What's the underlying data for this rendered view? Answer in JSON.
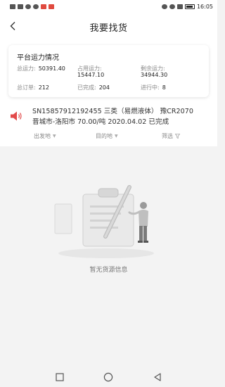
{
  "statusbar": {
    "time": "16:05"
  },
  "header": {
    "title": "我要找货"
  },
  "summary": {
    "title": "平台运力情况",
    "total_capacity_label": "总运力:",
    "total_capacity_value": "50391.40",
    "used_capacity_label": "占用运力:",
    "used_capacity_value": "15447.10",
    "remaining_capacity_label": "剩余运力:",
    "remaining_capacity_value": "34944.30",
    "total_orders_label": "总订单:",
    "total_orders_value": "212",
    "completed_label": "已完成:",
    "completed_value": "204",
    "in_progress_label": "进行中:",
    "in_progress_value": "8"
  },
  "notice": {
    "line1": "SN15857912192455 三类（易燃液体） 豫CR2070",
    "line2": "晋城市-洛阳市 70.00/吨 2020.04.02 已完成"
  },
  "filters": {
    "origin": "出发地",
    "destination": "目的地",
    "screen": "筛选"
  },
  "empty": {
    "text": "暂无货源信息"
  }
}
